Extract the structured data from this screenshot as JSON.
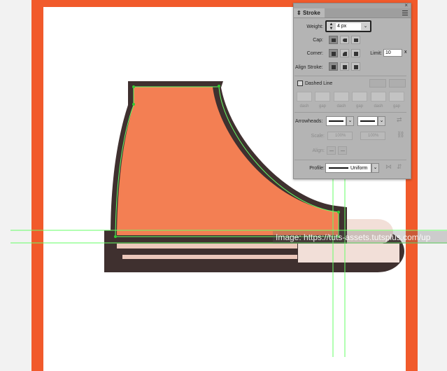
{
  "colors": {
    "frame": "#f15a2b",
    "shoe_body": "#f37f53",
    "shoe_outline": "#3f302f",
    "sole_light": "#f2dfd8",
    "sole_stripe": "#ecc8bb",
    "guide": "#66ff66",
    "panel_bg": "#b4b4b4"
  },
  "watermark": {
    "text": "Image: https://tuts-assets.tutsplus.com/up"
  },
  "panel": {
    "tab_label": "Stroke",
    "close_glyph": "×",
    "weight_label": "Weight:",
    "weight_value": "4 px",
    "cap_label": "Cap:",
    "corner_label": "Corner:",
    "limit_label": "Limit:",
    "limit_value": "10",
    "limit_unit": "x",
    "align_label": "Align Stroke:",
    "dashed_label": "Dashed Line",
    "dash_labels": [
      "dash",
      "gap",
      "dash",
      "gap",
      "dash",
      "gap"
    ],
    "arrowheads_label": "Arrowheads:",
    "scale_label": "Scale:",
    "scale_values": [
      "100%",
      "100%"
    ],
    "align_arrows_label": "Align:",
    "profile_label": "Profile:",
    "profile_value": "Uniform"
  }
}
